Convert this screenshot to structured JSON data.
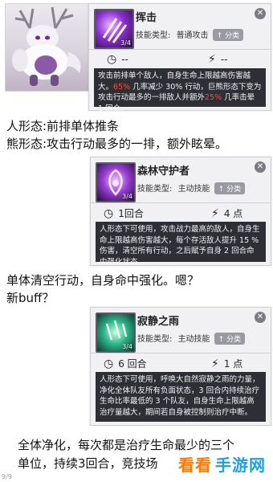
{
  "hero": {
    "alt": "hero portrait"
  },
  "cards": [
    {
      "name": "挥击",
      "level": "3/4",
      "type_label": "技能类型:",
      "type_value": "普通攻击",
      "tag": "分类",
      "cooldown": "--",
      "energy": "--",
      "desc_parts": [
        "攻击前排单个敌人，自身生命上限越高伤害越大。",
        "65%",
        " 几率减少 ",
        "30%",
        " 行动，巨熊形态下变为攻击行动最多的一排敌人并额外",
        "25%",
        " 几率击晕 1 回合。"
      ]
    },
    {
      "name": "森林守护者",
      "level": "3/4",
      "type_label": "技能类型:",
      "type_value": "主动技能",
      "tag": "分类",
      "cooldown": "1回合",
      "energy": "4 点",
      "description": "人形态下可使用，攻击战力最高的敌人，自身生命上限越高伤害越大，每个存活敌人提升 15 % 伤害，清空所有行动，之后赋予自身 2 回合命中强化状态。"
    },
    {
      "name": "寂静之雨",
      "level": "3/4",
      "type_label": "技能类型:",
      "type_value": "主动技能",
      "tag": "分类",
      "cooldown": "6 回合",
      "energy": "1 点",
      "description": "人形态下可使用，呼唤大自然寂静之雨的力量，净化全体队友所有负面状态，3 回合内持续治疗生命比率最低的 3 个队友，自身生命上限越高治疗量越大，期间若自身被控制则治疗中断。"
    }
  ],
  "notes": {
    "n1_line1": "人形态:前排单体推条",
    "n1_line2": "熊形态:攻击行动最多的一排，额外眩晕。",
    "n2_line1": "单体清空行动，自身命中强化。嗯？",
    "n2_line2": "新buff？",
    "n3_line1": "全体净化，每次都是治疗生命最少的三个",
    "n3_line2": "单位，持续3回合，竞技场"
  },
  "watermark": {
    "part1": "看看",
    "part2": "手游网"
  },
  "page_num": "9/9",
  "colors": {
    "highlight": "#f0503c",
    "desc_bg": "#2e2f36",
    "card_bg": "#f1f1f3"
  },
  "icons": [
    "clock-icon",
    "lightning-icon",
    "close-icon",
    "arrow-up-icon"
  ]
}
